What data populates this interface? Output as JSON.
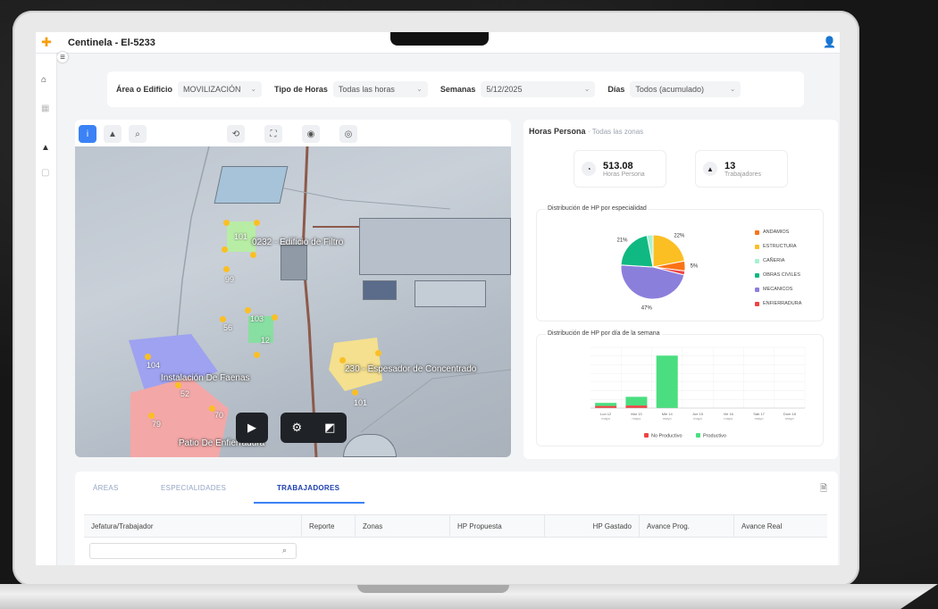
{
  "app": {
    "title": "Centinela - El-5233"
  },
  "filters": [
    {
      "label": "Área o Edificio",
      "value": "MOVILIZACIÓN"
    },
    {
      "label": "Tipo de Horas",
      "value": "Todas las horas"
    },
    {
      "label": "Semanas",
      "value": "5/12/2025"
    },
    {
      "label": "Días",
      "value": "Todos (acumulado)"
    }
  ],
  "map": {
    "zones": [
      {
        "label": "Instalación De Faenas"
      },
      {
        "label": "Patio De Enfierradura"
      },
      {
        "label": "0232 - Edificio de Filtro"
      },
      {
        "label": "230 - Espesador de Concentrado"
      }
    ],
    "numbers": [
      "101",
      "99",
      "56",
      "52",
      "70",
      "79",
      "104",
      "101",
      "103",
      "12"
    ]
  },
  "stats": {
    "title": "Horas Persona",
    "subtitle": "Todas las zonas",
    "kpis": [
      {
        "value": "513.08",
        "label": "Horas Persona",
        "icon": "clock-icon"
      },
      {
        "value": "13",
        "label": "Trabajadores",
        "icon": "worker-icon"
      }
    ],
    "pie_title": "Distribución de HP por especialidad",
    "pie_legend": [
      {
        "name": "ANDAMIOS",
        "color": "#f97316"
      },
      {
        "name": "ESTRUCTURA",
        "color": "#fbbf24"
      },
      {
        "name": "CAÑERIA",
        "color": "#a7f3d0"
      },
      {
        "name": "OBRAS CIVILES",
        "color": "#10b981"
      },
      {
        "name": "MECANICOS",
        "color": "#8b7fdc"
      },
      {
        "name": "ENFIERRADURA",
        "color": "#ef4444"
      }
    ],
    "bar_title": "Distribución de HP por día de la semana",
    "bar_legend": [
      {
        "name": "No Productivo",
        "color": "#ef4444"
      },
      {
        "name": "Productivo",
        "color": "#4ade80"
      }
    ]
  },
  "chart_data": [
    {
      "type": "pie",
      "title": "Distribución de HP por especialidad",
      "categories": [
        "ANDAMIOS",
        "ESTRUCTURA",
        "CAÑERIA",
        "OBRAS CIVILES",
        "MECANICOS",
        "ENFIERRADURA"
      ],
      "values": [
        5,
        22,
        3,
        21,
        47,
        2
      ],
      "labels": [
        "5%",
        "22%",
        "",
        "21%",
        "47%",
        ""
      ],
      "colors": [
        "#f97316",
        "#fbbf24",
        "#a7f3d0",
        "#10b981",
        "#8b7fdc",
        "#ef4444"
      ]
    },
    {
      "type": "bar",
      "title": "Distribución de HP por día de la semana",
      "categories": [
        "Lun 12 mayo",
        "Mar 13 mayo",
        "Mié 14 mayo",
        "Jue 15 mayo",
        "Vie 16 mayo",
        "Sáb 17 mayo",
        "Dom 18 mayo"
      ],
      "series": [
        {
          "name": "No Productivo",
          "values": [
            10,
            12,
            0,
            0,
            0,
            0,
            0
          ],
          "color": "#ef4444"
        },
        {
          "name": "Productivo",
          "values": [
            14,
            40,
            242,
            0,
            0,
            0,
            0
          ],
          "color": "#4ade80"
        }
      ],
      "data_labels": [
        "",
        "",
        "",
        "",
        "",
        "",
        ""
      ],
      "ylim": [
        0,
        280
      ]
    }
  ],
  "tabs": [
    "ÁREAS",
    "ESPECIALIDADES",
    "TRABAJADORES"
  ],
  "table": {
    "headers": [
      "Jefatura/Trabajador",
      "Reporte",
      "Zonas",
      "HP Propuesta",
      "HP Gastado",
      "Avance Prog.",
      "Avance Real"
    ]
  }
}
